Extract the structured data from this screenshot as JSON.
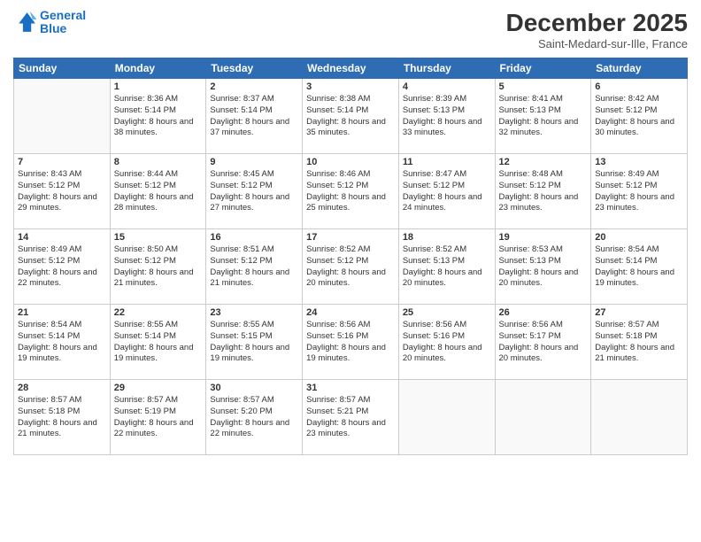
{
  "header": {
    "logo_line1": "General",
    "logo_line2": "Blue",
    "month": "December 2025",
    "location": "Saint-Medard-sur-Ille, France"
  },
  "days_of_week": [
    "Sunday",
    "Monday",
    "Tuesday",
    "Wednesday",
    "Thursday",
    "Friday",
    "Saturday"
  ],
  "weeks": [
    [
      {
        "day": "",
        "sunrise": "",
        "sunset": "",
        "daylight": ""
      },
      {
        "day": "1",
        "sunrise": "Sunrise: 8:36 AM",
        "sunset": "Sunset: 5:14 PM",
        "daylight": "Daylight: 8 hours and 38 minutes."
      },
      {
        "day": "2",
        "sunrise": "Sunrise: 8:37 AM",
        "sunset": "Sunset: 5:14 PM",
        "daylight": "Daylight: 8 hours and 37 minutes."
      },
      {
        "day": "3",
        "sunrise": "Sunrise: 8:38 AM",
        "sunset": "Sunset: 5:14 PM",
        "daylight": "Daylight: 8 hours and 35 minutes."
      },
      {
        "day": "4",
        "sunrise": "Sunrise: 8:39 AM",
        "sunset": "Sunset: 5:13 PM",
        "daylight": "Daylight: 8 hours and 33 minutes."
      },
      {
        "day": "5",
        "sunrise": "Sunrise: 8:41 AM",
        "sunset": "Sunset: 5:13 PM",
        "daylight": "Daylight: 8 hours and 32 minutes."
      },
      {
        "day": "6",
        "sunrise": "Sunrise: 8:42 AM",
        "sunset": "Sunset: 5:12 PM",
        "daylight": "Daylight: 8 hours and 30 minutes."
      }
    ],
    [
      {
        "day": "7",
        "sunrise": "Sunrise: 8:43 AM",
        "sunset": "Sunset: 5:12 PM",
        "daylight": "Daylight: 8 hours and 29 minutes."
      },
      {
        "day": "8",
        "sunrise": "Sunrise: 8:44 AM",
        "sunset": "Sunset: 5:12 PM",
        "daylight": "Daylight: 8 hours and 28 minutes."
      },
      {
        "day": "9",
        "sunrise": "Sunrise: 8:45 AM",
        "sunset": "Sunset: 5:12 PM",
        "daylight": "Daylight: 8 hours and 27 minutes."
      },
      {
        "day": "10",
        "sunrise": "Sunrise: 8:46 AM",
        "sunset": "Sunset: 5:12 PM",
        "daylight": "Daylight: 8 hours and 25 minutes."
      },
      {
        "day": "11",
        "sunrise": "Sunrise: 8:47 AM",
        "sunset": "Sunset: 5:12 PM",
        "daylight": "Daylight: 8 hours and 24 minutes."
      },
      {
        "day": "12",
        "sunrise": "Sunrise: 8:48 AM",
        "sunset": "Sunset: 5:12 PM",
        "daylight": "Daylight: 8 hours and 23 minutes."
      },
      {
        "day": "13",
        "sunrise": "Sunrise: 8:49 AM",
        "sunset": "Sunset: 5:12 PM",
        "daylight": "Daylight: 8 hours and 23 minutes."
      }
    ],
    [
      {
        "day": "14",
        "sunrise": "Sunrise: 8:49 AM",
        "sunset": "Sunset: 5:12 PM",
        "daylight": "Daylight: 8 hours and 22 minutes."
      },
      {
        "day": "15",
        "sunrise": "Sunrise: 8:50 AM",
        "sunset": "Sunset: 5:12 PM",
        "daylight": "Daylight: 8 hours and 21 minutes."
      },
      {
        "day": "16",
        "sunrise": "Sunrise: 8:51 AM",
        "sunset": "Sunset: 5:12 PM",
        "daylight": "Daylight: 8 hours and 21 minutes."
      },
      {
        "day": "17",
        "sunrise": "Sunrise: 8:52 AM",
        "sunset": "Sunset: 5:12 PM",
        "daylight": "Daylight: 8 hours and 20 minutes."
      },
      {
        "day": "18",
        "sunrise": "Sunrise: 8:52 AM",
        "sunset": "Sunset: 5:13 PM",
        "daylight": "Daylight: 8 hours and 20 minutes."
      },
      {
        "day": "19",
        "sunrise": "Sunrise: 8:53 AM",
        "sunset": "Sunset: 5:13 PM",
        "daylight": "Daylight: 8 hours and 20 minutes."
      },
      {
        "day": "20",
        "sunrise": "Sunrise: 8:54 AM",
        "sunset": "Sunset: 5:14 PM",
        "daylight": "Daylight: 8 hours and 19 minutes."
      }
    ],
    [
      {
        "day": "21",
        "sunrise": "Sunrise: 8:54 AM",
        "sunset": "Sunset: 5:14 PM",
        "daylight": "Daylight: 8 hours and 19 minutes."
      },
      {
        "day": "22",
        "sunrise": "Sunrise: 8:55 AM",
        "sunset": "Sunset: 5:14 PM",
        "daylight": "Daylight: 8 hours and 19 minutes."
      },
      {
        "day": "23",
        "sunrise": "Sunrise: 8:55 AM",
        "sunset": "Sunset: 5:15 PM",
        "daylight": "Daylight: 8 hours and 19 minutes."
      },
      {
        "day": "24",
        "sunrise": "Sunrise: 8:56 AM",
        "sunset": "Sunset: 5:16 PM",
        "daylight": "Daylight: 8 hours and 19 minutes."
      },
      {
        "day": "25",
        "sunrise": "Sunrise: 8:56 AM",
        "sunset": "Sunset: 5:16 PM",
        "daylight": "Daylight: 8 hours and 20 minutes."
      },
      {
        "day": "26",
        "sunrise": "Sunrise: 8:56 AM",
        "sunset": "Sunset: 5:17 PM",
        "daylight": "Daylight: 8 hours and 20 minutes."
      },
      {
        "day": "27",
        "sunrise": "Sunrise: 8:57 AM",
        "sunset": "Sunset: 5:18 PM",
        "daylight": "Daylight: 8 hours and 21 minutes."
      }
    ],
    [
      {
        "day": "28",
        "sunrise": "Sunrise: 8:57 AM",
        "sunset": "Sunset: 5:18 PM",
        "daylight": "Daylight: 8 hours and 21 minutes."
      },
      {
        "day": "29",
        "sunrise": "Sunrise: 8:57 AM",
        "sunset": "Sunset: 5:19 PM",
        "daylight": "Daylight: 8 hours and 22 minutes."
      },
      {
        "day": "30",
        "sunrise": "Sunrise: 8:57 AM",
        "sunset": "Sunset: 5:20 PM",
        "daylight": "Daylight: 8 hours and 22 minutes."
      },
      {
        "day": "31",
        "sunrise": "Sunrise: 8:57 AM",
        "sunset": "Sunset: 5:21 PM",
        "daylight": "Daylight: 8 hours and 23 minutes."
      },
      {
        "day": "",
        "sunrise": "",
        "sunset": "",
        "daylight": ""
      },
      {
        "day": "",
        "sunrise": "",
        "sunset": "",
        "daylight": ""
      },
      {
        "day": "",
        "sunrise": "",
        "sunset": "",
        "daylight": ""
      }
    ]
  ]
}
